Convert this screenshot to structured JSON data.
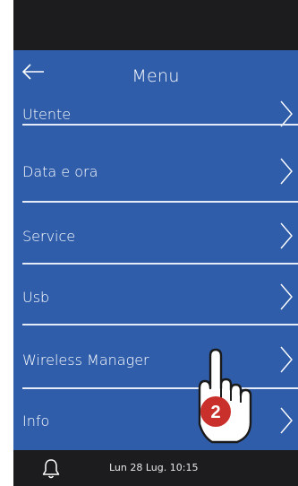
{
  "header": {
    "title": "Menu",
    "back_icon": "arrow-left-icon"
  },
  "menu": {
    "items": [
      {
        "label": "Utente"
      },
      {
        "label": "Data e ora"
      },
      {
        "label": "Service"
      },
      {
        "label": "Usb"
      },
      {
        "label": "Wireless Manager"
      },
      {
        "label": "Info"
      }
    ],
    "chevron_icon": "chevron-right-icon"
  },
  "footer": {
    "datetime": "Lun 28 Lug. 10:15",
    "bell_icon": "bell-icon"
  },
  "overlay": {
    "step_number": "2",
    "hand_icon": "pointing-hand-icon"
  },
  "colors": {
    "screen_bg": "#2f5daa",
    "frame": "#1c1c1f",
    "step_badge": "#c9302c"
  }
}
